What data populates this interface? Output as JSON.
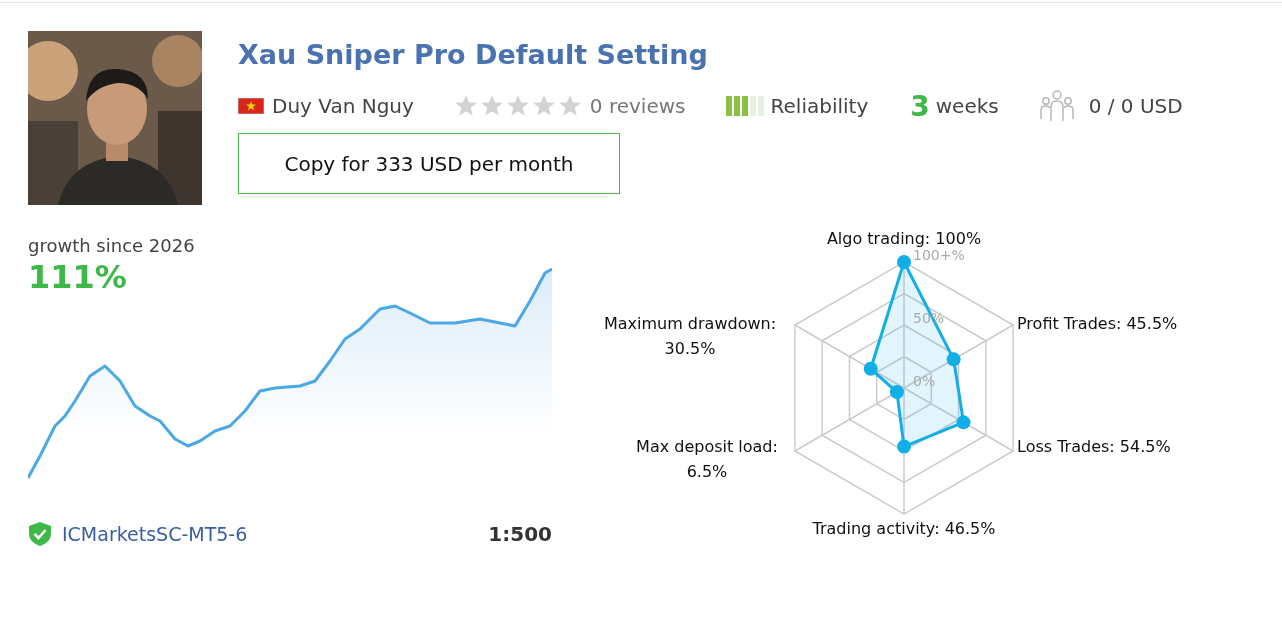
{
  "header": {
    "title": "Xau Sniper Pro Default Setting",
    "author": "Duy Van Nguy",
    "rating": {
      "stars": 0,
      "reviews": "0 reviews"
    },
    "reliability": {
      "level": 0.6,
      "label": "Reliability"
    },
    "age": {
      "number": "3",
      "unit": "weeks"
    },
    "subscribers": "0 / 0 USD",
    "copy_button": "Copy for 333 USD per month"
  },
  "growth": {
    "label": "growth since 2026",
    "value": "111%",
    "broker": "ICMarketsSC-MT5-6",
    "leverage": "1:500"
  },
  "radar": {
    "chart_data": {
      "type": "radar",
      "categories": [
        "Algo trading: 100%",
        "Profit Trades: 45.5%",
        "Loss Trades: 54.5%",
        "Trading activity: 46.5%",
        "Max deposit load:\n6.5%",
        "Maximum drawdown:\n30.5%"
      ],
      "series": [
        {
          "color": "#12aee8",
          "values": [
            100,
            45.5,
            54.5,
            46.5,
            6.5,
            30.5
          ]
        }
      ],
      "ylim": [
        0,
        100
      ],
      "yticks": [
        {
          "value": 0,
          "label": "0%"
        },
        {
          "value": 50,
          "label": "50%"
        },
        {
          "value": 100,
          "label": "100+%"
        }
      ]
    }
  }
}
